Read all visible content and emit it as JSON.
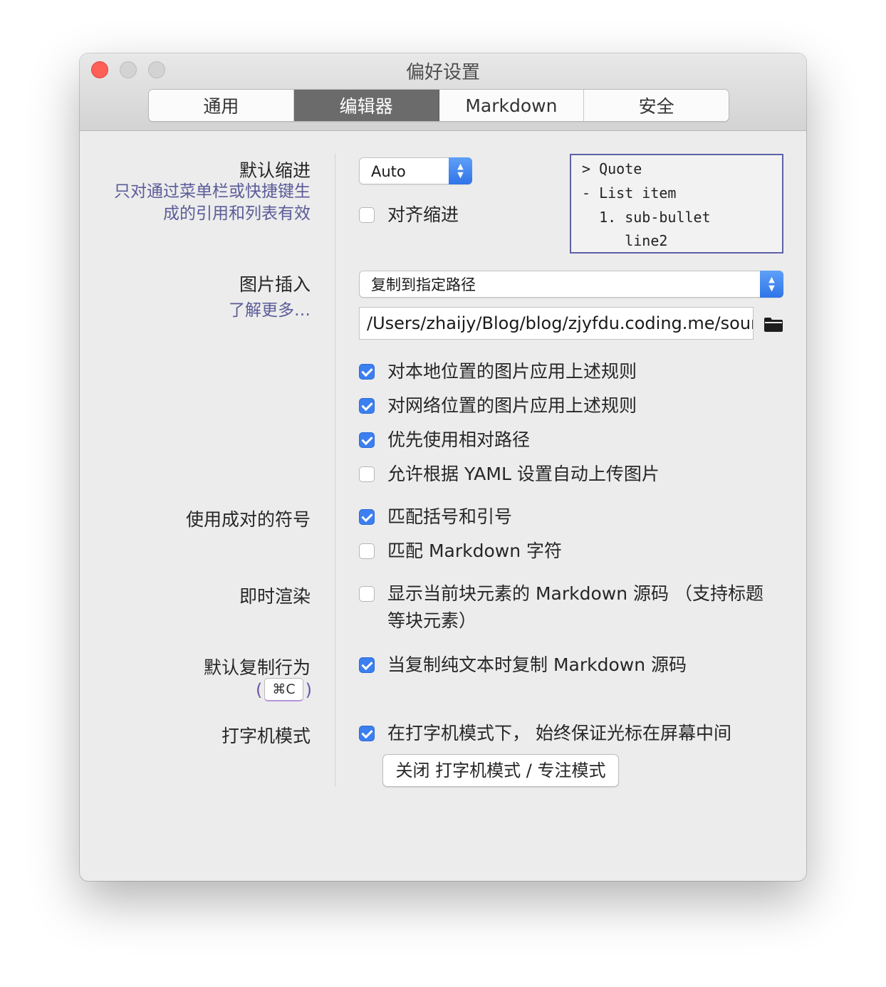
{
  "window": {
    "title": "偏好设置"
  },
  "tabs": [
    {
      "label": "通用"
    },
    {
      "label": "编辑器",
      "active": true
    },
    {
      "label": "Markdown"
    },
    {
      "label": "安全"
    }
  ],
  "indent": {
    "label": "默认缩进",
    "hint_line1": "只对通过菜单栏或快捷键生",
    "hint_line2": "成的引用和列表有效",
    "select_value": "Auto",
    "align_checkbox": {
      "label": "对齐缩进",
      "checked": false
    },
    "preview_lines": [
      "> Quote",
      "- List item",
      "  1. sub-bullet",
      "     line2"
    ]
  },
  "image": {
    "label": "图片插入",
    "learn_more": "了解更多…",
    "select_value": "复制到指定路径",
    "path_value": "/Users/zhaijy/Blog/blog/zjyfdu.coding.me/source/images",
    "options": [
      {
        "label": "对本地位置的图片应用上述规则",
        "checked": true
      },
      {
        "label": "对网络位置的图片应用上述规则",
        "checked": true
      },
      {
        "label": "优先使用相对路径",
        "checked": true
      },
      {
        "label": "允许根据 YAML 设置自动上传图片",
        "checked": false
      }
    ]
  },
  "pairs": {
    "label": "使用成对的符号",
    "options": [
      {
        "label": "匹配括号和引号",
        "checked": true
      },
      {
        "label": "匹配 Markdown 字符",
        "checked": false
      }
    ]
  },
  "live_render": {
    "label": "即时渲染",
    "option": {
      "label_line1": "显示当前块元素的 Markdown 源码 （支持标题",
      "label_line2": "等块元素）",
      "checked": false
    }
  },
  "copy": {
    "label": "默认复制行为",
    "kbd_open": "(",
    "kbd": "⌘C",
    "kbd_close": ")",
    "option": {
      "label": "当复制纯文本时复制 Markdown 源码",
      "checked": true
    }
  },
  "typewriter": {
    "label": "打字机模式",
    "option": {
      "label": "在打字机模式下， 始终保证光标在屏幕中间",
      "checked": true
    },
    "button_label": "关闭 打字机模式 / 专注模式"
  },
  "colors": {
    "accent": "#3b7ff0",
    "hint_text": "#5b5b99",
    "active_tab": "#6b6b6b",
    "close_button": "#fe5f57"
  }
}
